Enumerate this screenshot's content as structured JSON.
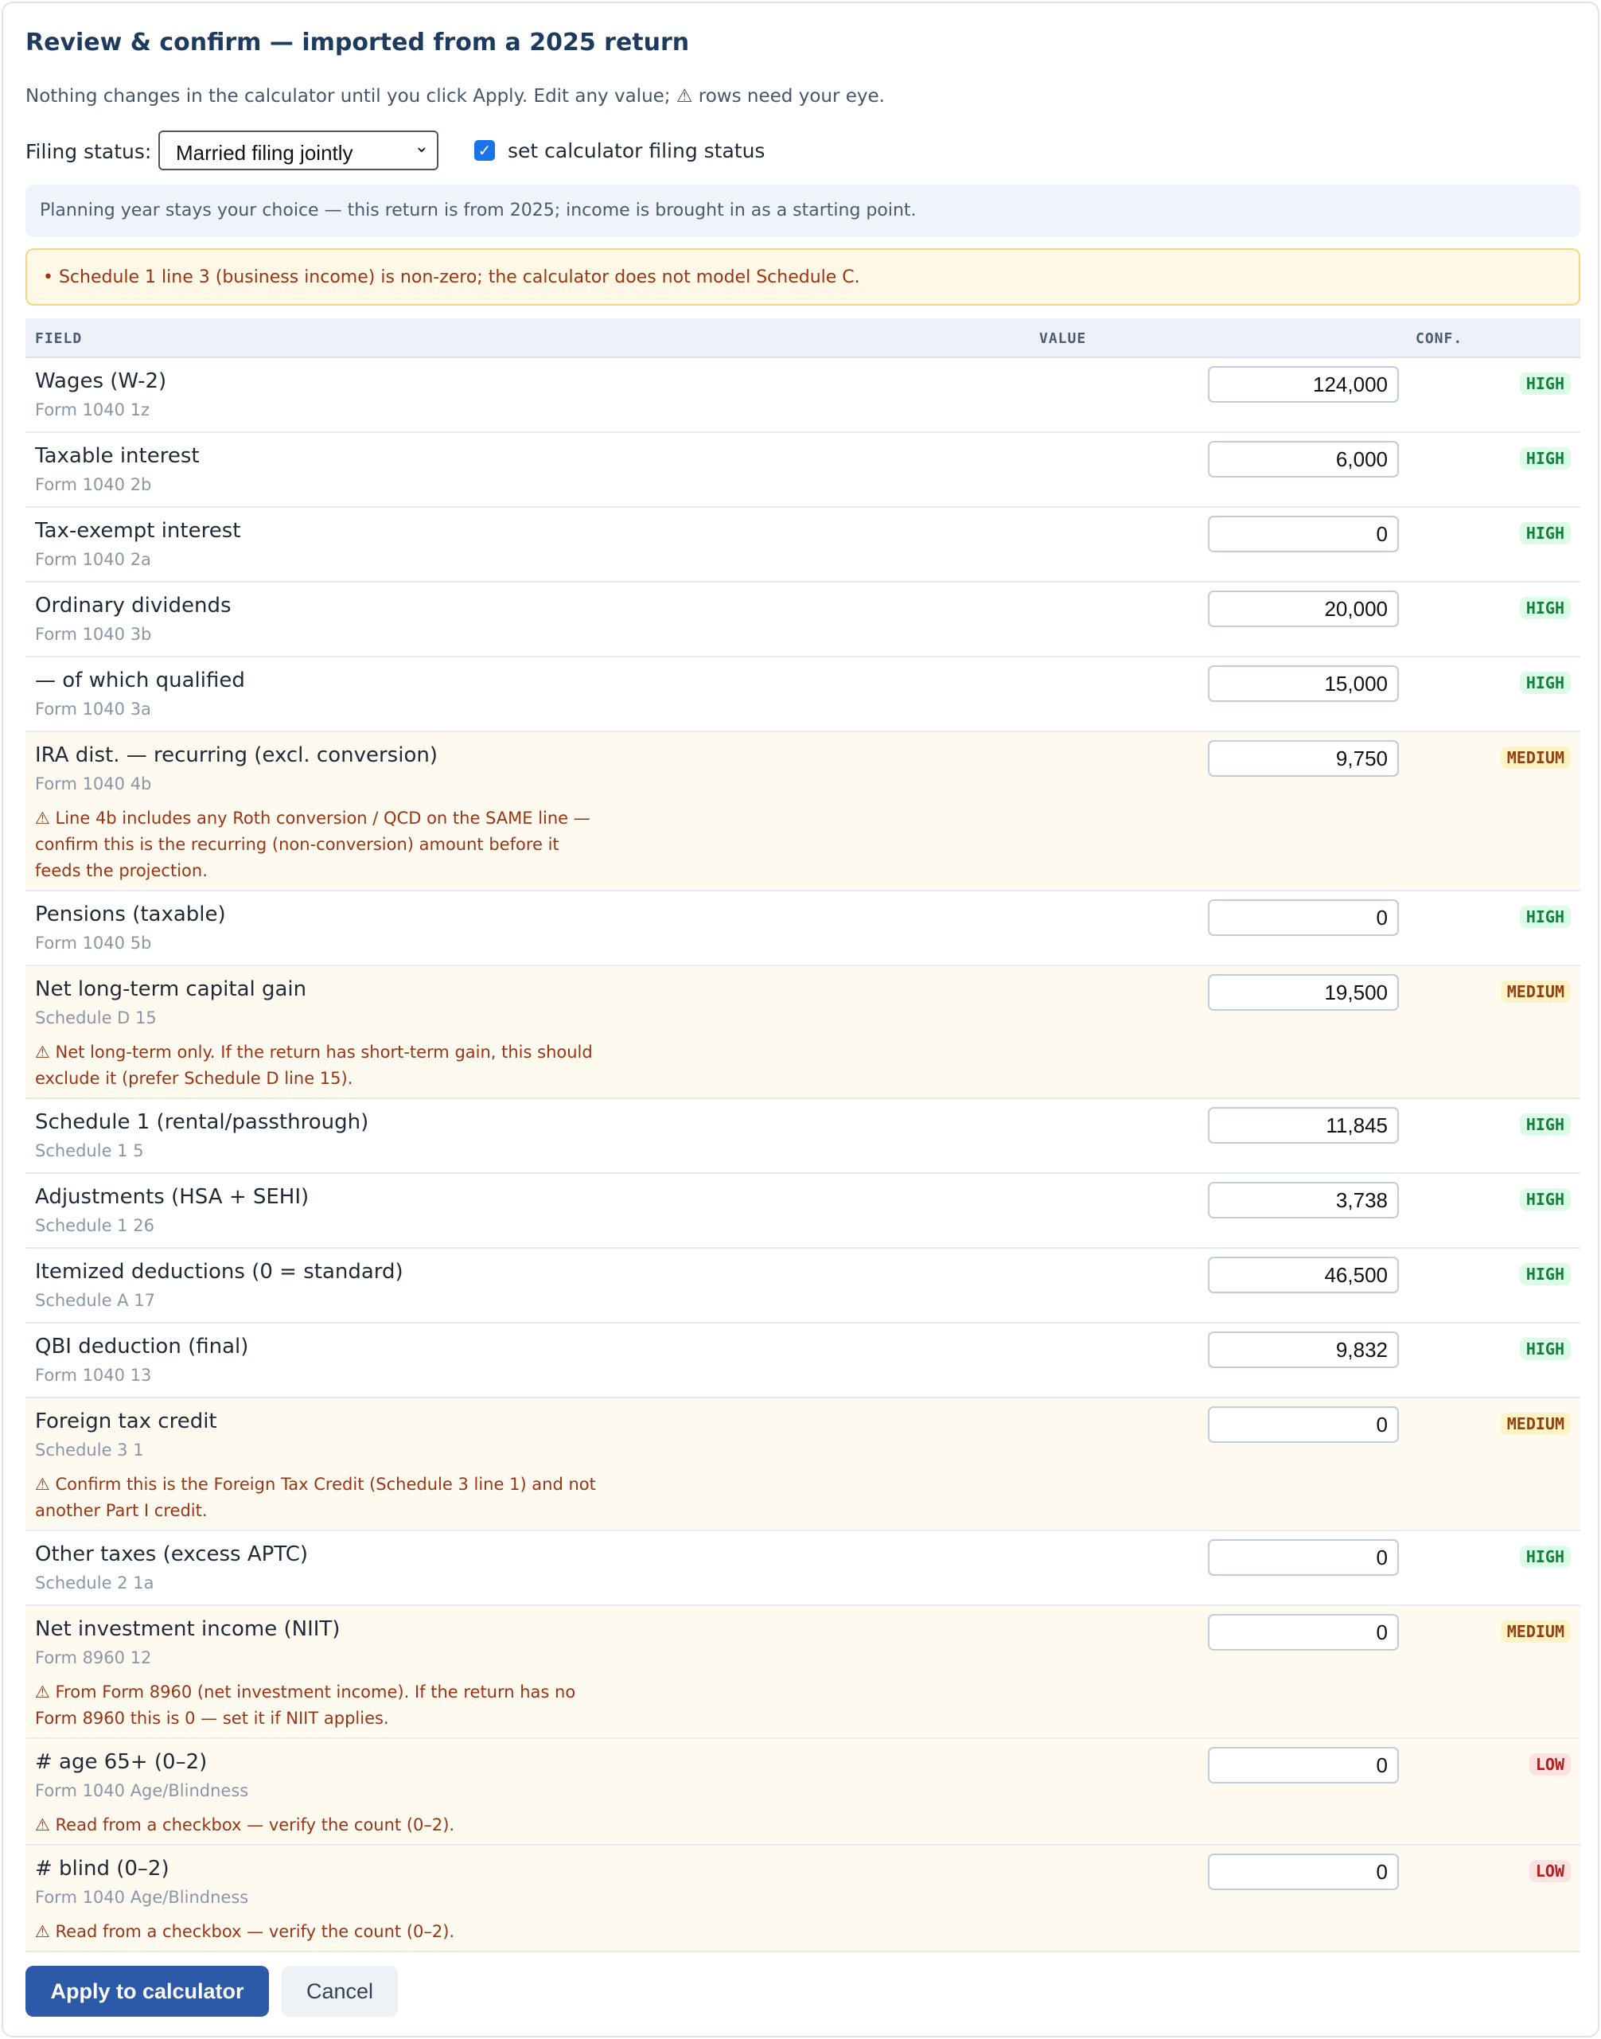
{
  "header": {
    "title": "Review & confirm — imported from a 2025 return",
    "subtitle": "Nothing changes in the calculator until you click Apply. Edit any value; ⚠ rows need your eye."
  },
  "filing": {
    "label": "Filing status:",
    "selected": "Married filing jointly",
    "checkbox_checked": true,
    "checkbox_label": "set calculator filing status"
  },
  "info_text": "Planning year stays your choice — this return is from 2025; income is brought in as a starting point.",
  "warning_text": "• Schedule 1 line 3 (business income) is non-zero; the calculator does not model Schedule C.",
  "table": {
    "headers": {
      "field": "FIELD",
      "value": "VALUE",
      "conf": "CONF."
    },
    "rows": [
      {
        "label": "Wages (W-2)",
        "source": "Form 1040 1z",
        "value": "124,000",
        "conf": "HIGH",
        "level": "high"
      },
      {
        "label": "Taxable interest",
        "source": "Form 1040 2b",
        "value": "6,000",
        "conf": "HIGH",
        "level": "high"
      },
      {
        "label": "Tax-exempt interest",
        "source": "Form 1040 2a",
        "value": "0",
        "conf": "HIGH",
        "level": "high"
      },
      {
        "label": "Ordinary dividends",
        "source": "Form 1040 3b",
        "value": "20,000",
        "conf": "HIGH",
        "level": "high"
      },
      {
        "label": "— of which qualified",
        "source": "Form 1040 3a",
        "value": "15,000",
        "conf": "HIGH",
        "level": "high"
      },
      {
        "label": "IRA dist. — recurring (excl. conversion)",
        "source": "Form 1040 4b",
        "value": "9,750",
        "conf": "MEDIUM",
        "level": "medium",
        "note": "⚠ Line 4b includes any Roth conversion / QCD on the SAME line — confirm this is the recurring (non-conversion) amount before it feeds the projection."
      },
      {
        "label": "Pensions (taxable)",
        "source": "Form 1040 5b",
        "value": "0",
        "conf": "HIGH",
        "level": "high"
      },
      {
        "label": "Net long-term capital gain",
        "source": "Schedule D 15",
        "value": "19,500",
        "conf": "MEDIUM",
        "level": "medium",
        "note": "⚠ Net long-term only. If the return has short-term gain, this should exclude it (prefer Schedule D line 15)."
      },
      {
        "label": "Schedule 1 (rental/passthrough)",
        "source": "Schedule 1 5",
        "value": "11,845",
        "conf": "HIGH",
        "level": "high"
      },
      {
        "label": "Adjustments (HSA + SEHI)",
        "source": "Schedule 1 26",
        "value": "3,738",
        "conf": "HIGH",
        "level": "high"
      },
      {
        "label": "Itemized deductions (0 = standard)",
        "source": "Schedule A 17",
        "value": "46,500",
        "conf": "HIGH",
        "level": "high"
      },
      {
        "label": "QBI deduction (final)",
        "source": "Form 1040 13",
        "value": "9,832",
        "conf": "HIGH",
        "level": "high"
      },
      {
        "label": "Foreign tax credit",
        "source": "Schedule 3 1",
        "value": "0",
        "conf": "MEDIUM",
        "level": "medium",
        "note": "⚠ Confirm this is the Foreign Tax Credit (Schedule 3 line 1) and not another Part I credit."
      },
      {
        "label": "Other taxes (excess APTC)",
        "source": "Schedule 2 1a",
        "value": "0",
        "conf": "HIGH",
        "level": "high"
      },
      {
        "label": "Net investment income (NIIT)",
        "source": "Form 8960 12",
        "value": "0",
        "conf": "MEDIUM",
        "level": "medium",
        "note": "⚠ From Form 8960 (net investment income). If the return has no Form 8960 this is 0 — set it if NIIT applies."
      },
      {
        "label": "# age 65+ (0–2)",
        "source": "Form 1040 Age/Blindness",
        "value": "0",
        "conf": "LOW",
        "level": "low",
        "note": "⚠ Read from a checkbox — verify the count (0–2)."
      },
      {
        "label": "# blind (0–2)",
        "source": "Form 1040 Age/Blindness",
        "value": "0",
        "conf": "LOW",
        "level": "low",
        "note": "⚠ Read from a checkbox — verify the count (0–2)."
      }
    ]
  },
  "actions": {
    "apply_label": "Apply to calculator",
    "cancel_label": "Cancel"
  }
}
